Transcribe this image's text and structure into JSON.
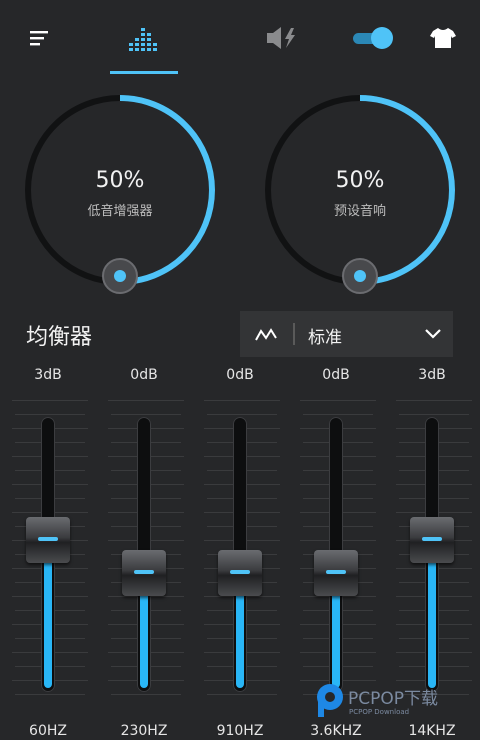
{
  "colors": {
    "background": "#262729",
    "accent": "#4fc3f7",
    "track": "#0d0e0f",
    "panel": "#333436"
  },
  "topbar": {
    "icons": [
      "menu-icon",
      "equalizer-icon",
      "volume-boost-icon",
      "toggle-switch",
      "tshirt-icon"
    ],
    "active_tab": "equalizer",
    "toggle_on": true
  },
  "dials": [
    {
      "value": "50%",
      "label": "低音增强器",
      "level": 0.5
    },
    {
      "value": "50%",
      "label": "预设音响",
      "level": 0.5
    }
  ],
  "equalizer": {
    "title": "均衡器",
    "preset": "标准",
    "bands": [
      {
        "gain": "3dB",
        "freq": "60HZ",
        "level": 0.62
      },
      {
        "gain": "0dB",
        "freq": "230HZ",
        "level": 0.5
      },
      {
        "gain": "0dB",
        "freq": "910HZ",
        "level": 0.5
      },
      {
        "gain": "0dB",
        "freq": "3.6KHZ",
        "level": 0.5
      },
      {
        "gain": "3dB",
        "freq": "14KHZ",
        "level": 0.62
      }
    ]
  },
  "watermark": {
    "text": "PCPOP下载",
    "subtext": "PCPOP Download"
  }
}
